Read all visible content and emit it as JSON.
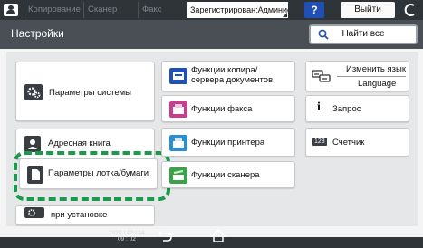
{
  "topbar": {
    "tabs": [
      "Копирование",
      "Сканер",
      "Факс"
    ],
    "status_text": "Зарегистрирован:Администратор аппарат",
    "help_label": "?",
    "logout_label": "Выйти"
  },
  "header": {
    "title": "Настройки",
    "search_label": "Найти все"
  },
  "tiles": {
    "system_settings": "Параметры системы",
    "address_book": "Адресная книга",
    "tray_paper": "Параметры лотка/бумаги",
    "setup": "при установке",
    "copier_line1": "Функции копира/",
    "copier_line2": "сервера документов",
    "fax": "Функции факса",
    "printer": "Функции принтера",
    "scanner": "Функции сканера",
    "language_line1": "Изменить язык",
    "language_line2": "Language",
    "inquiry": "Запрос",
    "counter": "Счетчик",
    "counter_icon_text": "123",
    "inquiry_icon_text": "i"
  },
  "footer": {
    "date": "2020 / 12 / 04",
    "time": "09 : 02"
  },
  "colors": {
    "topbar": "#2f3439",
    "header": "#4a4f55",
    "focus": "#1a9a4a",
    "help": "#1f50b5"
  },
  "icons": [
    "user-icon",
    "power-icon",
    "search-icon",
    "gear-icon",
    "address-book-icon",
    "paper-tray-icon",
    "copier-icon",
    "fax-icon",
    "printer-icon",
    "scanner-icon",
    "language-icon",
    "info-icon",
    "counter-icon",
    "back-icon",
    "home-icon"
  ]
}
